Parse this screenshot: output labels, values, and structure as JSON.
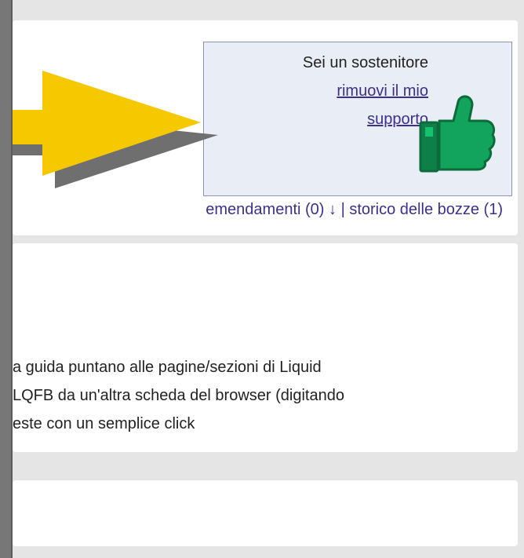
{
  "support": {
    "status": "Sei un sostenitore",
    "remove_line1": "rimuovi il mio",
    "remove_line2": "supporto"
  },
  "links": {
    "amendments": "emendamenti (0) ↓",
    "separator": "|",
    "drafts": "storico delle bozze (1)"
  },
  "guide": {
    "lines": [
      "a guida puntano alle pagine/sezioni di Liquid",
      " LQFB da un'altra scheda del browser (digitando",
      "este con un semplice click"
    ]
  },
  "icons": {
    "thumb": "thumbs-up-icon",
    "arrow": "yellow-pointer-arrow"
  },
  "colors": {
    "arrow_yellow": "#f5c800",
    "thumb_green": "#12a45c",
    "link_purple": "#3f2f8a"
  }
}
